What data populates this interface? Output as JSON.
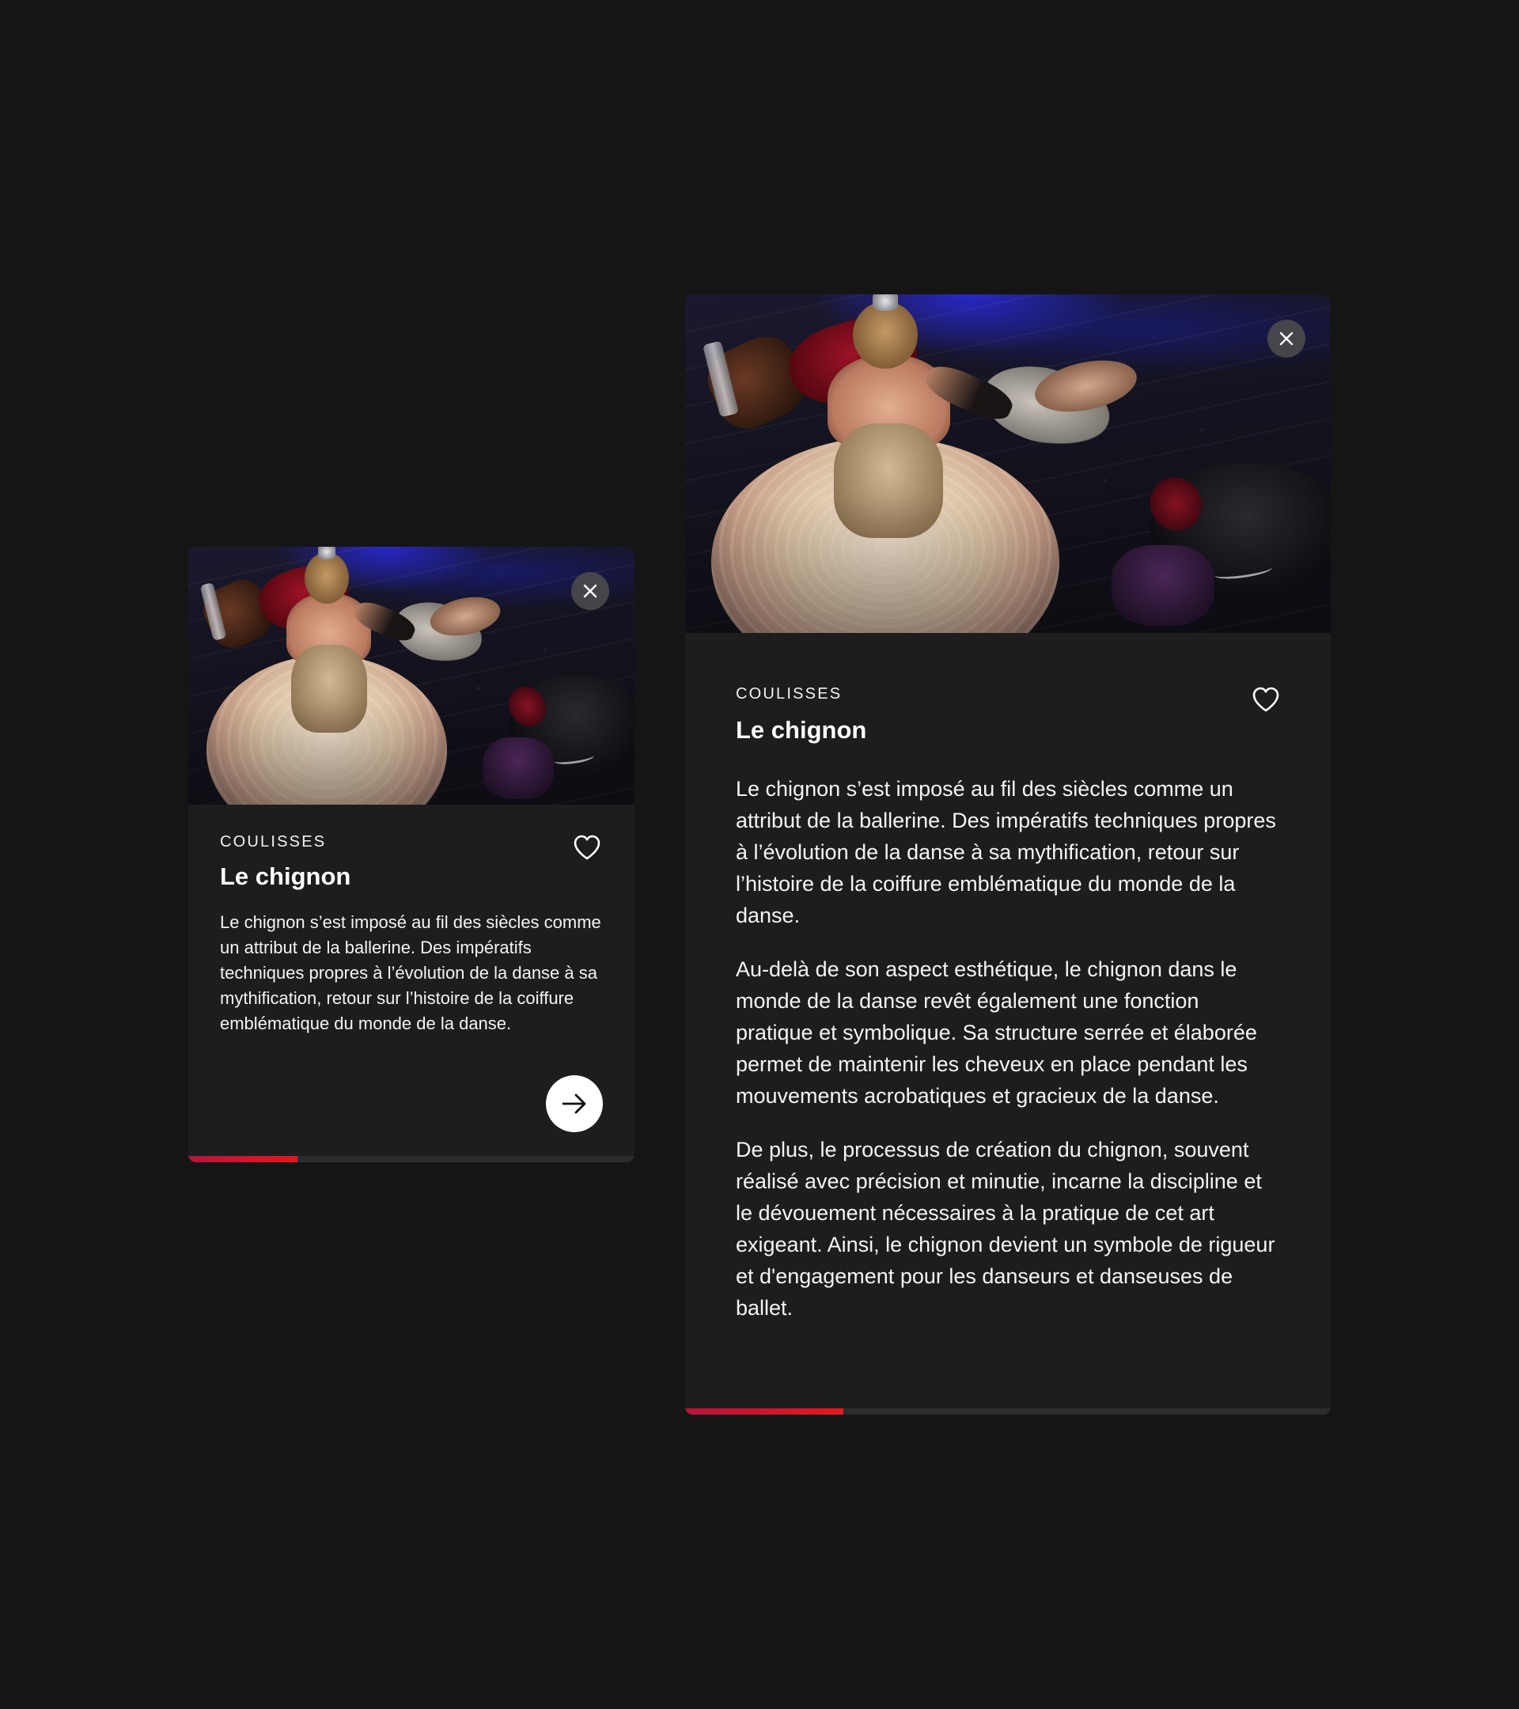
{
  "colors": {
    "background": "#151515",
    "card": "#1d1d1e",
    "progress_accent": "#e3171f",
    "progress_track": "#2c2c2e"
  },
  "card_preview": {
    "category": "COULISSES",
    "title": "Le chignon",
    "excerpt": "Le chignon s’est imposé au fil des siècles comme un attribut de la ballerine. Des impératifs techniques propres à l’évolution de la danse à sa mythification, retour sur l’histoire de la coiffure emblématique du monde de la danse.",
    "icons": {
      "close": "close-icon",
      "favorite": "heart-icon",
      "next": "arrow-right-icon"
    },
    "progress": 0.245
  },
  "card_expanded": {
    "category": "COULISSES",
    "title": "Le chignon",
    "paragraphs": [
      "Le chignon s’est imposé au fil des siècles comme un attribut de la ballerine. Des impératifs techniques propres à l’évolution de la danse à sa mythification, retour sur l’histoire de la coiffure emblématique du monde de la danse.",
      "Au-delà de son aspect esthétique, le chignon dans le monde de la danse revêt également une fonction pratique et symbolique. Sa structure serrée et élaborée permet de maintenir les cheveux en place pendant les mouvements acrobatiques et gracieux de la danse.",
      "De plus, le processus de création du chignon, souvent réalisé avec précision et minutie, incarne la discipline et le dévouement nécessaires à la pratique de cet art exigeant. Ainsi, le chignon devient un symbole de rigueur et d'engagement pour les danseurs et danseuses de ballet."
    ],
    "icons": {
      "close": "close-icon",
      "favorite": "heart-icon"
    },
    "progress": 0.245
  }
}
